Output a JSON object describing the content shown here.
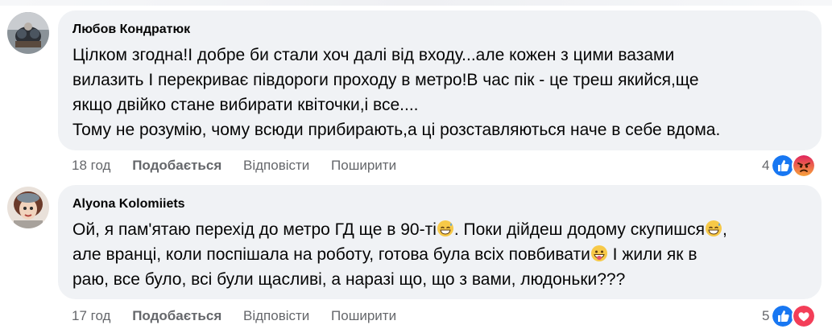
{
  "comments": [
    {
      "author": "Любов Кондратюк",
      "lines": [
        "Цілком згодна!І добре би стали хоч далі від входу...але кожен з цими вазами",
        "вилазить І перекриває півдороги проходу в метро!В час пік - це треш якийся,ще",
        "якщо двійко стане вибирати квіточки,і все....",
        "Тому не розумію, чому всюди прибирають,а ці розставляються наче в себе вдома."
      ],
      "time": "18 год",
      "like_label": "Подобається",
      "reply_label": "Відповісти",
      "share_label": "Поширити",
      "reaction_count": "4",
      "reactions": [
        "like-icon",
        "angry-icon"
      ]
    },
    {
      "author": "Alyona Kolomiiets",
      "line1_a": "Ой, я пам'ятаю перехід до метро ГД ще в 90-ті",
      "line1_b": ". Поки дійдеш додому скупишся",
      "line1_c": ",",
      "line2_a": "але вранці, коли поспішала на роботу, готова була всіх повбивати",
      "line2_b": " І жили як в",
      "line3": "раю, все було, всі були щасливі, а наразі що, що з вами, людоньки???",
      "time": "17 год",
      "like_label": "Подобається",
      "reply_label": "Відповісти",
      "share_label": "Поширити",
      "reaction_count": "5",
      "reactions": [
        "like-icon",
        "love-icon"
      ]
    }
  ],
  "colors": {
    "bubble": "#f0f2f5",
    "meta_text": "#65676b",
    "like_blue": "#1877f2",
    "love_red": "#f33e58",
    "angry_orange": "#e9710f"
  }
}
